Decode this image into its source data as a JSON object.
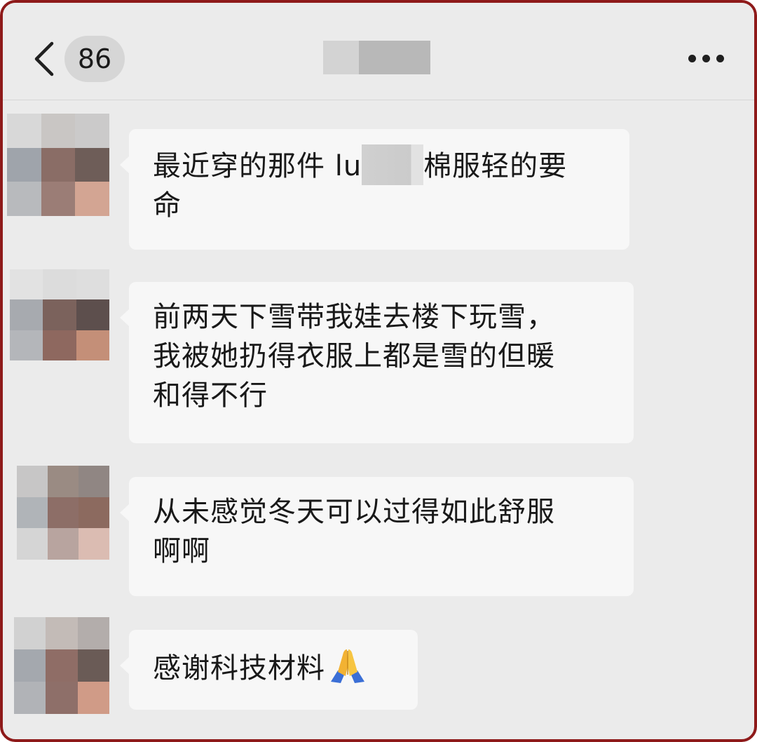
{
  "header": {
    "unread_count": "86"
  },
  "messages": [
    {
      "before_redaction": "最近穿的那件 lu",
      "after_redaction": "棉服轻的要\n命"
    },
    {
      "text": "前两天下雪带我娃去楼下玩雪，\n我被她扔得衣服上都是雪的但暖\n和得不行"
    },
    {
      "text": "从未感觉冬天可以过得如此舒服\n啊啊"
    },
    {
      "text": "感谢科技材料",
      "emoji": "folded-hands-icon"
    }
  ],
  "colors": {
    "background": "#ebebeb",
    "bubble": "#f7f7f7",
    "text": "#191919",
    "frame_border": "#8e1a1a",
    "badge": "#d6d6d6"
  }
}
